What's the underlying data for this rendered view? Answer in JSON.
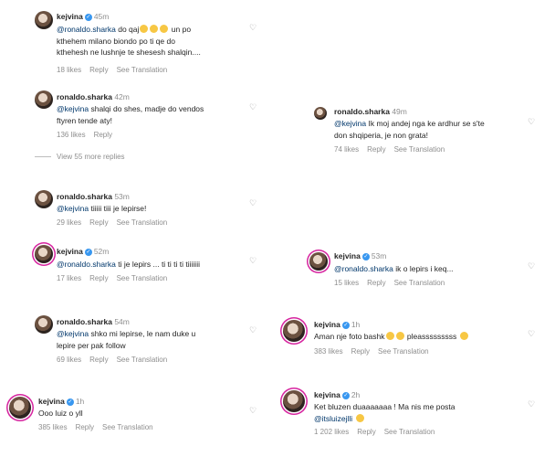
{
  "comments": [
    {
      "user": "kejvina",
      "time": "45m",
      "mention": "@ronaldo.sharka",
      "line1": "do qaj",
      "line1b": "un po",
      "line2": "kthehem milano biondo po ti qe do",
      "line3": "kthehesh ne lushnje te shesesh shalqin....",
      "likes": "18 likes",
      "reply": "Reply",
      "translate": "See Translation"
    },
    {
      "user": "ronaldo.sharka",
      "time": "42m",
      "mention": "@kejvina",
      "line1": "shalqi do shes, madje do vendos",
      "line2": "ftyren tende aty!",
      "likes": "136 likes",
      "reply": "Reply"
    },
    {
      "view_more": "View 55 more replies"
    },
    {
      "user": "ronaldo.sharka",
      "time": "53m",
      "mention": "@kejvina",
      "line1": "tiiiii tiii je lepirse!",
      "likes": "29 likes",
      "reply": "Reply",
      "translate": "See Translation"
    },
    {
      "user": "kejvina",
      "time": "52m",
      "mention": "@ronaldo.sharka",
      "line1": "ti je lepirs ... ti ti ti ti tiiiiiii",
      "likes": "17 likes",
      "reply": "Reply",
      "translate": "See Translation"
    },
    {
      "user": "ronaldo.sharka",
      "time": "54m",
      "mention": "@kejvina",
      "line1": "shko mi lepirse, le nam duke u",
      "line2": "lepire per pak follow",
      "likes": "69 likes",
      "reply": "Reply",
      "translate": "See Translation"
    },
    {
      "user": "kejvina",
      "time": "1h",
      "line1": "Ooo luiz o yll",
      "likes": "385 likes",
      "reply": "Reply",
      "translate": "See Translation"
    },
    {
      "user": "ronaldo.sharka",
      "time": "49m",
      "mention": "@kejvina",
      "line1": "Ik moj andej nga ke ardhur se s'te",
      "line2": "don shqiperia, je non grata!",
      "likes": "74 likes",
      "reply": "Reply",
      "translate": "See Translation"
    },
    {
      "user": "kejvina",
      "time": "53m",
      "mention": "@ronaldo.sharka",
      "line1": "ik o lepirs i keq...",
      "likes": "15 likes",
      "reply": "Reply",
      "translate": "See Translation"
    },
    {
      "user": "kejvina",
      "time": "1h",
      "line1": "Aman nje foto bashk",
      "line1b": "pleasssssssss",
      "likes": "383 likes",
      "reply": "Reply",
      "translate": "See Translation"
    },
    {
      "user": "kejvina",
      "time": "2h",
      "line1": "Ket bluzen duaaaaaaa ! Ma nis me posta",
      "mention2": "@itsluizejlli",
      "likes": "1 202 likes",
      "reply": "Reply",
      "translate": "See Translation"
    }
  ],
  "verified_mark": "✓",
  "heart_icon": "♡"
}
